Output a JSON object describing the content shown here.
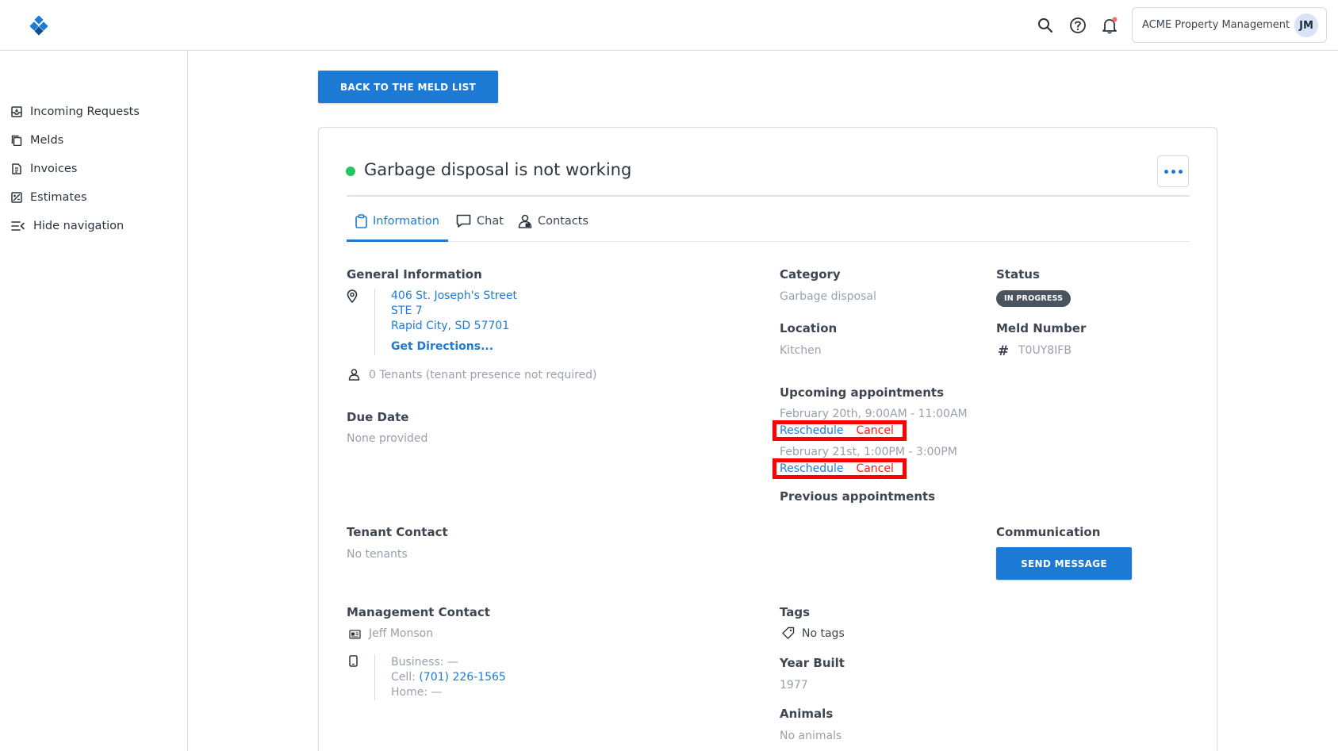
{
  "header": {
    "org_name": "ACME Property Management",
    "avatar_initials": "JM",
    "icons": [
      "search-icon",
      "help-icon",
      "bell-icon"
    ]
  },
  "sidebar": {
    "items": [
      {
        "label": "Incoming Requests",
        "icon": "inbox-icon"
      },
      {
        "label": "Melds",
        "icon": "copy-icon"
      },
      {
        "label": "Invoices",
        "icon": "invoice-icon"
      },
      {
        "label": "Estimates",
        "icon": "estimate-icon"
      },
      {
        "label": "Hide navigation",
        "icon": "collapse-icon"
      }
    ]
  },
  "main": {
    "back_label": "BACK TO THE MELD LIST",
    "title": "Garbage disposal is not working",
    "status_color": "#22c55e",
    "tabs": [
      {
        "label": "Information",
        "icon": "clipboard-icon"
      },
      {
        "label": "Chat",
        "icon": "chat-icon"
      },
      {
        "label": "Contacts",
        "icon": "contacts-icon"
      }
    ],
    "general": {
      "heading": "General Information",
      "address1": "406 St. Joseph's Street",
      "address2": "STE 7",
      "address3": "Rapid City, SD 57701",
      "directions": "Get Directions...",
      "tenants": "0 Tenants (tenant presence not required)"
    },
    "due": {
      "heading": "Due Date",
      "value": "None provided"
    },
    "category": {
      "heading": "Category",
      "value": "Garbage disposal"
    },
    "location": {
      "heading": "Location",
      "value": "Kitchen"
    },
    "status": {
      "heading": "Status",
      "value": "IN PROGRESS"
    },
    "meld_number": {
      "heading": "Meld Number",
      "value": "T0UY8IFB"
    },
    "appointments": {
      "upcoming_heading": "Upcoming appointments",
      "items": [
        {
          "time": "February 20th, 9:00AM - 11:00AM",
          "reschedule": "Reschedule",
          "cancel": "Cancel"
        },
        {
          "time": "February 21st, 1:00PM - 3:00PM",
          "reschedule": "Reschedule",
          "cancel": "Cancel"
        }
      ],
      "previous_heading": "Previous appointments"
    },
    "tenant_contact": {
      "heading": "Tenant Contact",
      "value": "No tenants"
    },
    "communication": {
      "heading": "Communication",
      "button": "SEND MESSAGE"
    },
    "management": {
      "heading": "Management Contact",
      "name": "Jeff Monson",
      "business_label": "Business:",
      "business_value": "—",
      "cell_label": "Cell:",
      "cell_value": "(701) 226-1565",
      "home_label": "Home:",
      "home_value": "—"
    },
    "tags": {
      "heading": "Tags",
      "value": "No tags"
    },
    "year_built": {
      "heading": "Year Built",
      "value": "1977"
    },
    "animals": {
      "heading": "Animals",
      "value": "No animals"
    }
  },
  "colors": {
    "accent": "#1d7ad4",
    "highlight": "#ff0000"
  }
}
